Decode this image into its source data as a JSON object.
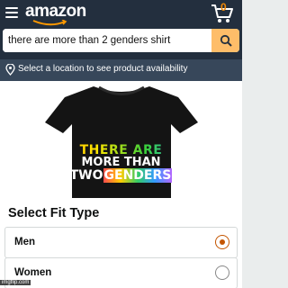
{
  "header": {
    "logo": "amazon",
    "cart_count": "0",
    "accent_color": "#febd69"
  },
  "search": {
    "value": "there are more than 2 genders shirt"
  },
  "location": {
    "text": "Select a location to see product availability"
  },
  "product": {
    "shirt_text": {
      "line1": "THERE ARE",
      "line2": "MORE THAN",
      "line3a": "TWO",
      "line3b": "GENDERS"
    }
  },
  "fit": {
    "title": "Select Fit Type",
    "options": [
      {
        "label": "Men",
        "selected": true
      },
      {
        "label": "Women",
        "selected": false
      }
    ]
  },
  "watermark": "imgflip.com"
}
